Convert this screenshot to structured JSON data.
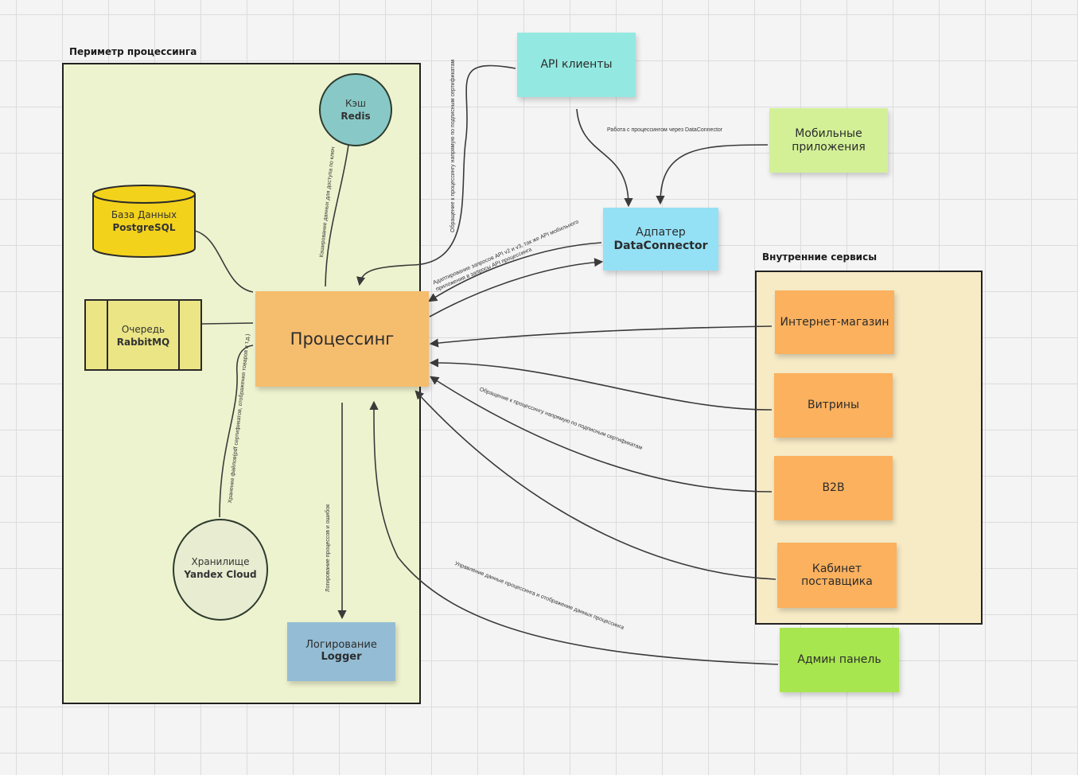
{
  "groups": {
    "perimeter": "Периметр процессинга",
    "internal": "Внутренние сервисы"
  },
  "nodes": {
    "processing": "Процессинг",
    "cache": {
      "line1": "Кэш",
      "line2": "Redis"
    },
    "db": {
      "line1": "База Данных",
      "line2": "PostgreSQL"
    },
    "queue": {
      "line1": "Очередь",
      "line2": "RabbitMQ"
    },
    "storage": {
      "line1": "Хранилище",
      "line2": "Yandex Cloud"
    },
    "logger": {
      "line1": "Логирование",
      "line2": "Logger"
    },
    "api_clients": "API клиенты",
    "mobile": "Мобильные приложения",
    "adapter": {
      "line1": "Адпатер",
      "line2": "DataConnector"
    },
    "shop": "Интернет-магазин",
    "showcases": "Витрины",
    "b2b": "B2B",
    "supplier": "Кабинет поставщика",
    "admin": "Админ панель"
  },
  "edge_labels": {
    "cache_edge": "Кэширование данных для доступа по ключ",
    "api_direct": "Обращение к процессингу напрямую по подписным сертификатам",
    "adapter_work": "Работа с процессингом через DataConnector",
    "adapter_adapt": "Адаптирование запросов API v2 и v3, так же API мобильного приложения в запросы API процессинга",
    "internal_direct": "Обращение к процессингу напрямую по подписным сертификатам",
    "storage_edge": "Хранение файлов(pdf сертификатов, отображения товаров и т.д.)",
    "logging_edge": "Логирование процессов и ошибок",
    "admin_edge": "Управление данные процессинга и отображение данных процессинга"
  },
  "colors": {
    "perimeter_bg": "#eef3cf",
    "internal_bg": "#f7ebc6",
    "processing": "#f5bd6e",
    "redis": "#88c9c7",
    "postgres": "#f3d21c",
    "rabbit": "#ebe586",
    "yandex": "#e8ecd0",
    "logger": "#94bdd5",
    "api_clients": "#93e9e1",
    "mobile": "#d3f097",
    "adapter": "#94e1f6",
    "orange_sticky": "#fbb15e",
    "admin": "#a7e64e",
    "line": "#3a3a3a"
  }
}
